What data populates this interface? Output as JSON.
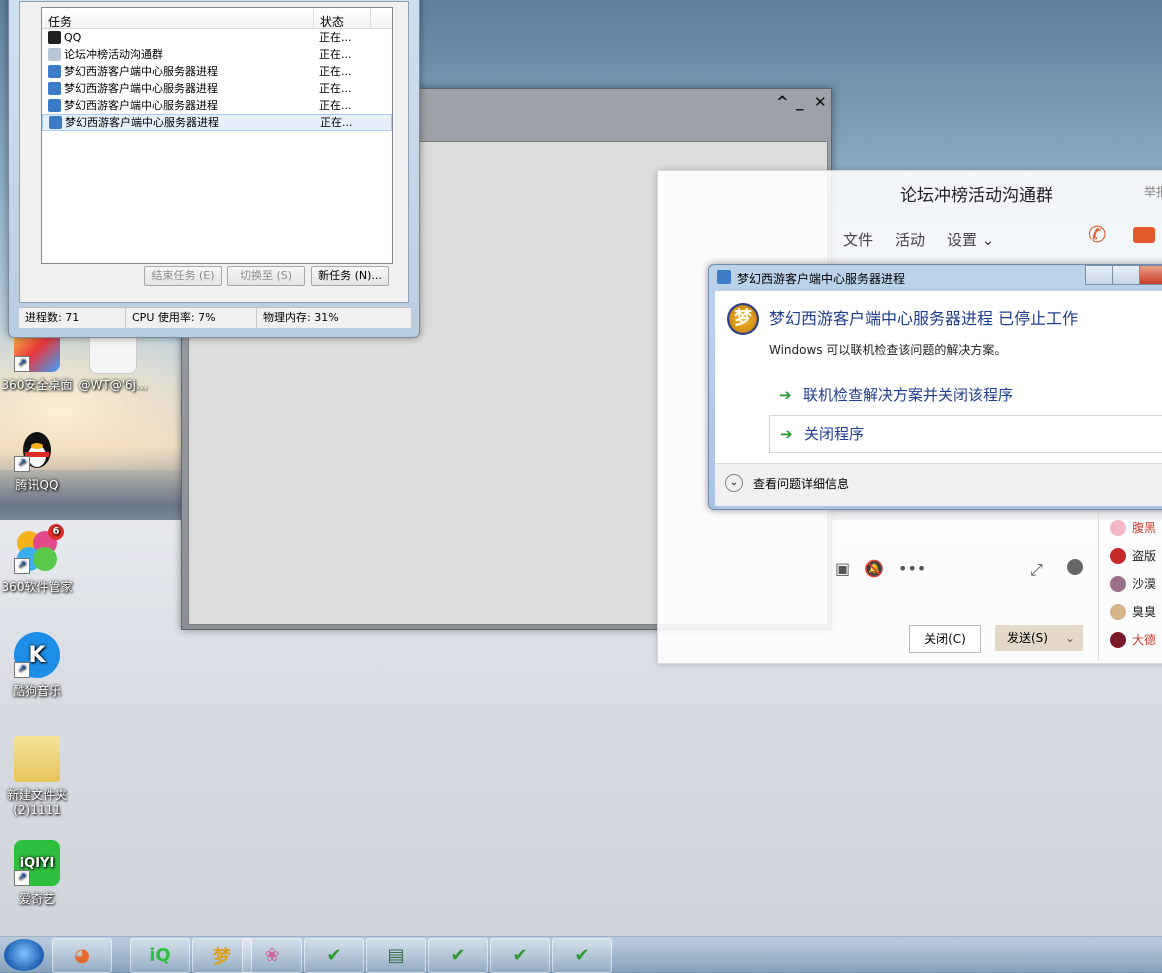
{
  "desktop": {
    "icons": [
      {
        "label": "360安全桌面"
      },
      {
        "label": "@WT@'6j..."
      },
      {
        "label": "腾讯QQ"
      },
      {
        "label": "360软件管家",
        "badge": "6"
      },
      {
        "label": "酷狗音乐",
        "glyph": "K"
      },
      {
        "label": "新建文件夹(2)1111"
      },
      {
        "label": "爱奇艺",
        "glyph": "iQIYI"
      }
    ]
  },
  "taskmgr": {
    "columns": {
      "task": "任务",
      "status": "状态"
    },
    "rows": [
      {
        "name": "QQ",
        "status": "正在..."
      },
      {
        "name": "论坛冲榜活动沟通群",
        "status": "正在..."
      },
      {
        "name": "梦幻西游客户端中心服务器进程",
        "status": "正在..."
      },
      {
        "name": "梦幻西游客户端中心服务器进程",
        "status": "正在..."
      },
      {
        "name": "梦幻西游客户端中心服务器进程",
        "status": "正在..."
      },
      {
        "name": "梦幻西游客户端中心服务器进程",
        "status": "正在..."
      }
    ],
    "buttons": {
      "end_task": "结束任务 (E)",
      "switch_to": "切换至 (S)",
      "new_task": "新任务 (N)..."
    },
    "status": {
      "processes": "进程数: 71",
      "cpu": "CPU 使用率: 7%",
      "memory": "物理内存: 31%"
    }
  },
  "qqchat": {
    "title": "论坛冲榜活动沟通群",
    "report": "举报",
    "tabs": [
      "文件",
      "活动",
      "设置 ⌄"
    ],
    "close_label": "关闭(C)",
    "send_label": "发送(S)",
    "members": [
      {
        "name": "腹黑",
        "color": "#d03a2a",
        "av": "#f2b8c6"
      },
      {
        "name": "盗版",
        "color": "#222",
        "av": "#c42a2a"
      },
      {
        "name": "沙漠",
        "color": "#222",
        "av": "#9c6e8a"
      },
      {
        "name": "臭臭",
        "color": "#222",
        "av": "#d9b48a"
      },
      {
        "name": "大德",
        "color": "#d03a2a",
        "av": "#7a1a2a"
      }
    ]
  },
  "errdlg": {
    "title": "梦幻西游客户端中心服务器进程",
    "logo": "梦",
    "heading": "梦幻西游客户端中心服务器进程 已停止工作",
    "subtext": "Windows 可以联机检查该问题的解决方案。",
    "option1": "联机检查解决方案并关闭该程序",
    "option2": "关闭程序",
    "details": "查看问题详细信息"
  },
  "taskbar": {
    "items": [
      {
        "glyph": "◕",
        "color": "#e46a2a"
      },
      {
        "glyph": "iQ",
        "color": "#2fbf3f"
      },
      {
        "glyph": "梦",
        "color": "#d8a21c"
      },
      {
        "glyph": "❀",
        "color": "#c86a9a"
      },
      {
        "glyph": "✔",
        "color": "#2f9a2f"
      },
      {
        "glyph": "▤",
        "color": "#3a6a4a"
      },
      {
        "glyph": "✔",
        "color": "#2f9a2f"
      },
      {
        "glyph": "✔",
        "color": "#2f9a2f"
      },
      {
        "glyph": "✔",
        "color": "#2f9a2f"
      }
    ]
  }
}
